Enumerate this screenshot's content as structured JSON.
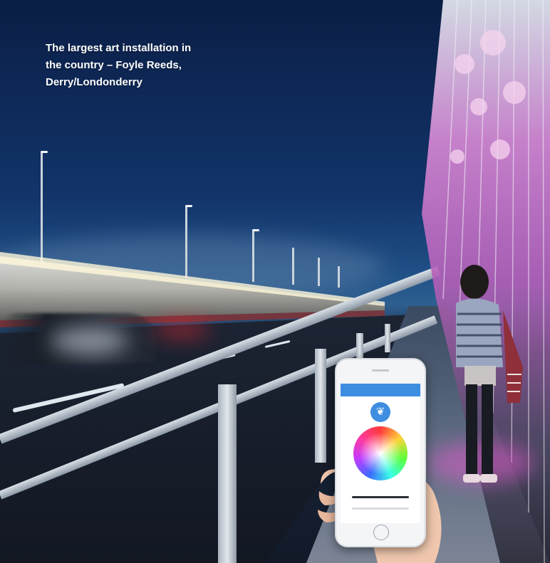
{
  "caption": {
    "text": "The largest art installation in the country – Foyle Reeds, Derry/Londonderry"
  },
  "phone_app": {
    "icon_name": "leaf-logo-icon",
    "accent_color": "#3d8de0"
  },
  "colors": {
    "sky": "#0a1e45",
    "reed_pink": "#e85fc3",
    "road": "#121722"
  }
}
